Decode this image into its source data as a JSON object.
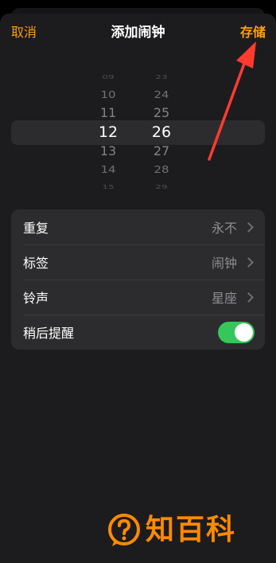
{
  "nav": {
    "cancel": "取消",
    "title": "添加闹钟",
    "save": "存储"
  },
  "picker": {
    "hours": [
      "09",
      "10",
      "11",
      "12",
      "13",
      "14",
      "15"
    ],
    "minutes": [
      "23",
      "24",
      "25",
      "26",
      "27",
      "28",
      "29"
    ],
    "selected_hour": "12",
    "selected_minute": "26"
  },
  "settings": {
    "repeat": {
      "label": "重复",
      "value": "永不",
      "chevron_icon": "chevron-right-icon"
    },
    "label": {
      "label": "标签",
      "value": "闹钟",
      "chevron_icon": "chevron-right-icon"
    },
    "sound": {
      "label": "铃声",
      "value": "星座",
      "chevron_icon": "chevron-right-icon"
    },
    "snooze": {
      "label": "稍后提醒",
      "on": true
    }
  },
  "annotation": {
    "arrow_color": "#ff3b30",
    "icon": "red-arrow-icon"
  },
  "watermark": {
    "text": "知百科",
    "icon": "question-bubble-icon",
    "color": "#ff8a00"
  },
  "colors": {
    "accent": "#ff9f0a",
    "toggle_on": "#34c759",
    "background": "#1c1c1e",
    "group_background": "#2c2c2e"
  }
}
